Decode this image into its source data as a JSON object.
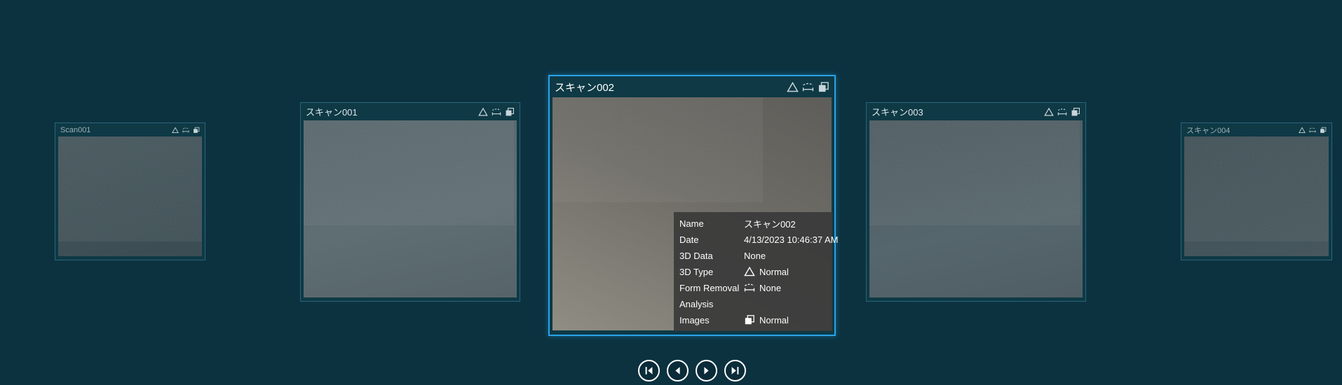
{
  "colors": {
    "background": "#0c3240",
    "card_border": "#2b6478",
    "selected_border": "#29a3e8",
    "overlay_background": "#3a3a3a",
    "text": "#ffffff"
  },
  "cards": [
    {
      "title": "Scan001",
      "selected": false
    },
    {
      "title": "スキャン001",
      "selected": false
    },
    {
      "title": "スキャン002",
      "selected": true
    },
    {
      "title": "スキャン003",
      "selected": false
    },
    {
      "title": "スキャン004",
      "selected": false
    }
  ],
  "card_header_icons": [
    "triangle-icon",
    "form-removal-icon",
    "images-icon"
  ],
  "info_panel": {
    "rows": [
      {
        "label": "Name",
        "value": "スキャン002"
      },
      {
        "label": "Date",
        "value": "4/13/2023 10:46:37 AM"
      },
      {
        "label": "3D Data",
        "value": "None"
      },
      {
        "label": "3D Type",
        "value": "Normal",
        "icon": "triangle-icon"
      },
      {
        "label": "Form Removal",
        "value": "None",
        "icon": "form-removal-icon"
      },
      {
        "label": "Analysis",
        "value": ""
      },
      {
        "label": "Images",
        "value": "Normal",
        "icon": "images-icon"
      }
    ]
  },
  "nav": {
    "first": "first",
    "previous": "previous",
    "next": "next",
    "last": "last"
  }
}
